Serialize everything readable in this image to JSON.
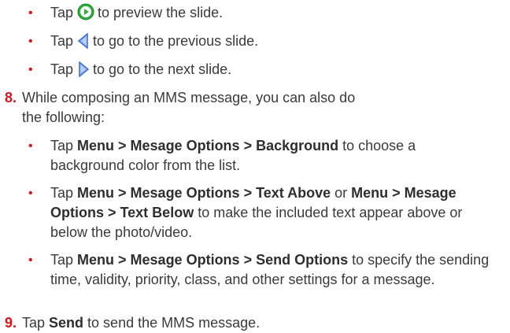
{
  "bullets_top": [
    {
      "before": "Tap",
      "icon": "play-icon",
      "after": "to preview the slide."
    },
    {
      "before": "Tap",
      "icon": "previous-slide-arrow-icon",
      "after": "to go to the previous slide."
    },
    {
      "before": "Tap",
      "icon": "next-slide-arrow-icon",
      "after": "to go to the next slide."
    }
  ],
  "step8": {
    "number": "8.",
    "text": "While composing an MMS message, you can also do the following:",
    "bullets": [
      {
        "pre": "Tap ",
        "bold": "Menu > Mesage Options > Background",
        "post": " to choose a background color from the list."
      },
      {
        "pre": "Tap ",
        "bold": "Menu > Mesage Options > Text Above",
        "mid": " or ",
        "bold2": "Menu > Mesage Options > Text Below",
        "post": " to make the included text appear above or below the photo/video."
      },
      {
        "pre": "Tap ",
        "bold": "Menu > Mesage Options > Send Options",
        "post": " to specify the sending time, validity, priority, class, and other settings for a message."
      }
    ]
  },
  "step9": {
    "number": "9.",
    "pre": "Tap ",
    "bold": "Send",
    "post": " to send the MMS message."
  },
  "colors": {
    "bullet": "#d9141b",
    "text": "#3a3a3a",
    "icon_green": "#2fae3a",
    "icon_blue": "#3d6fd1"
  }
}
